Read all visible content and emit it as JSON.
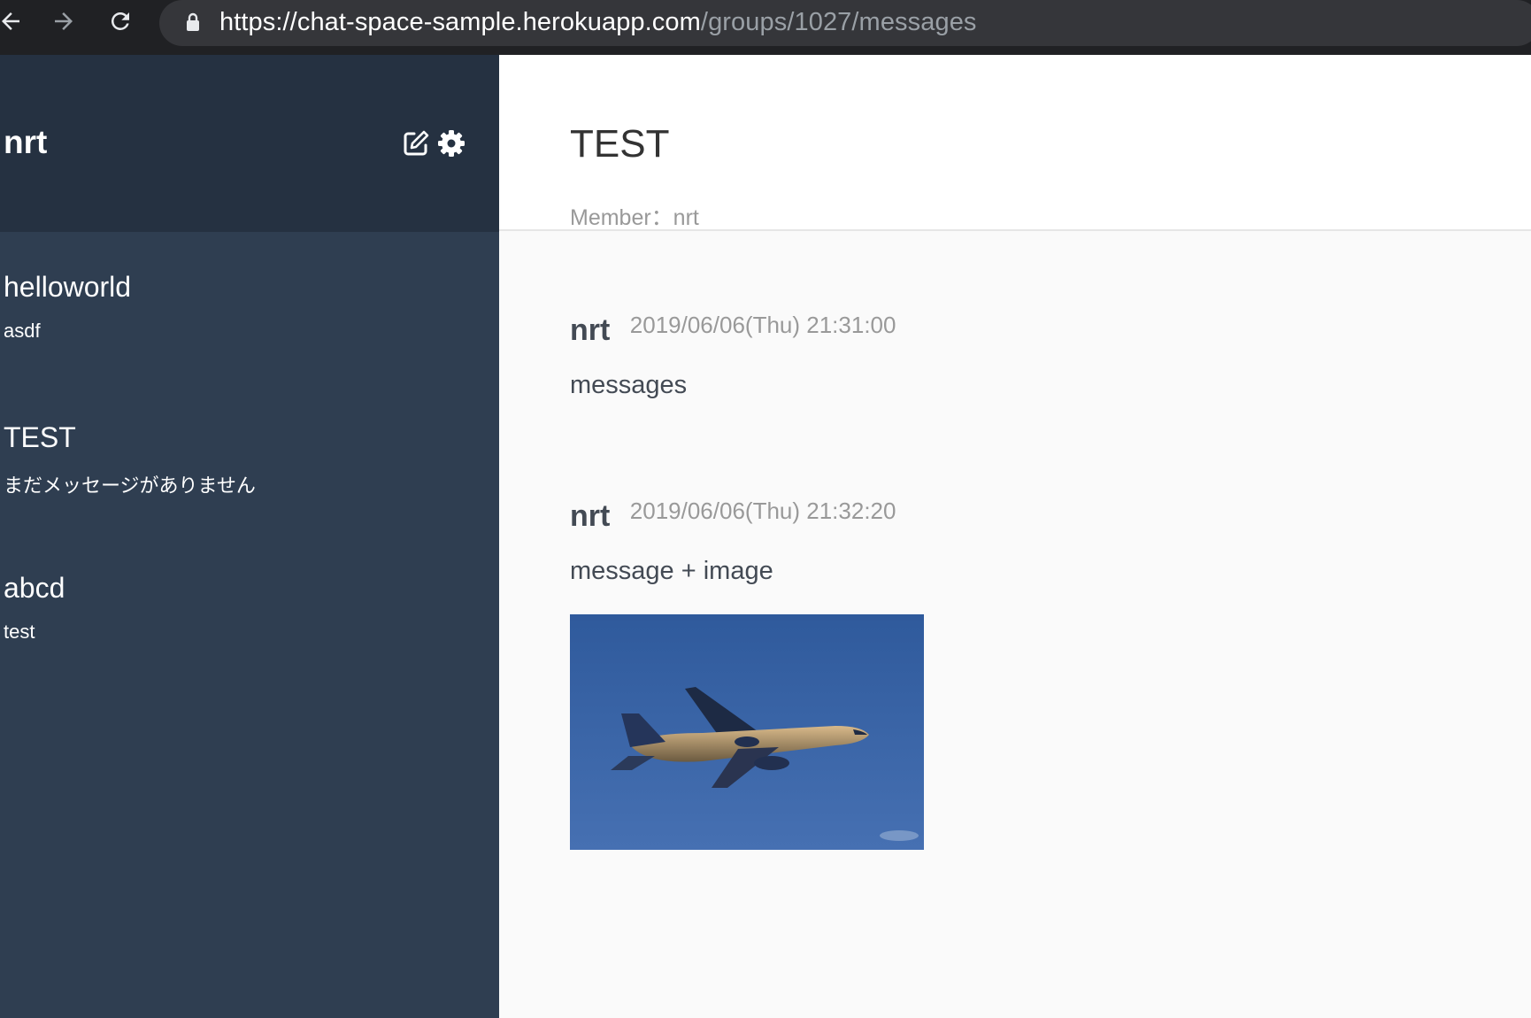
{
  "browser": {
    "url_host": "https://chat-space-sample.herokuapp.com",
    "url_path": "/groups/1027/messages"
  },
  "sidebar": {
    "user_name": "nrt",
    "groups": [
      {
        "name": "helloworld",
        "last_message": "asdf"
      },
      {
        "name": "TEST",
        "last_message": "まだメッセージがありません"
      },
      {
        "name": "abcd",
        "last_message": "test"
      }
    ]
  },
  "main": {
    "group_name": "TEST",
    "members_line": "Member：nrt",
    "messages": [
      {
        "user": "nrt",
        "date": "2019/06/06(Thu) 21:31:00",
        "text": "messages"
      },
      {
        "user": "nrt",
        "date": "2019/06/06(Thu) 21:32:20",
        "text": "message + image",
        "image_alt": "ANA 787 airplane in blue sky"
      }
    ]
  },
  "colors": {
    "sidebar_header": "#253141",
    "sidebar_body": "#2f3e51",
    "main_bg": "#fafafa",
    "browser_chrome": "#202124"
  }
}
